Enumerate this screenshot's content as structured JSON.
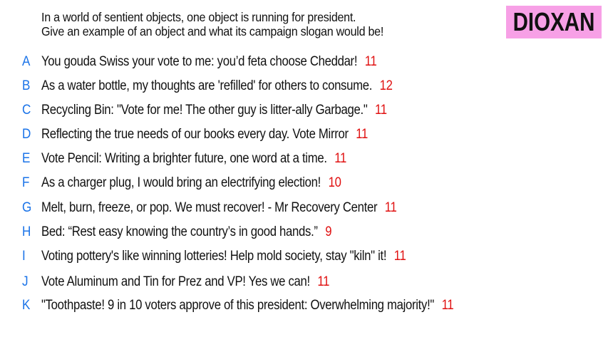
{
  "prompt": {
    "line1": "In a world of sentient objects, one object is running for president.",
    "line2": "Give an example of an object and what its campaign slogan would be!"
  },
  "badge": {
    "label": "DIOXAN",
    "color": "#f7a0e6"
  },
  "colors": {
    "letter": "#1a73e8",
    "score": "#e01010"
  },
  "answers": [
    {
      "letter": "A",
      "text": "You gouda Swiss your vote to me: you’d feta choose Cheddar!",
      "score": "11"
    },
    {
      "letter": "B",
      "text": "As a water bottle, my thoughts are 'refilled' for others to consume.",
      "score": "12"
    },
    {
      "letter": "C",
      "text": "Recycling Bin: \"Vote for me! The other guy is litter-ally Garbage.\"",
      "score": "11"
    },
    {
      "letter": "D",
      "text": "Reflecting the true needs of our books every day. Vote Mirror",
      "score": "11"
    },
    {
      "letter": "E",
      "text": "Vote Pencil: Writing a brighter future, one word at a time.",
      "score": "11"
    },
    {
      "letter": "F",
      "text": "As a charger plug, I would bring an electrifying election!",
      "score": "10"
    },
    {
      "letter": "G",
      "text": "Melt, burn, freeze, or pop. We must recover! - Mr Recovery Center",
      "score": "11"
    },
    {
      "letter": "H",
      "text": "Bed: “Rest easy knowing the country’s in good hands.”",
      "score": "9"
    },
    {
      "letter": "I",
      "text": "Voting pottery's like winning lotteries! Help mold society, stay \"kiln\" it!",
      "score": "11"
    },
    {
      "letter": "J",
      "text": "Vote Aluminum and Tin for Prez and VP! Yes we can!",
      "score": "11"
    },
    {
      "letter": "K",
      "text": "\"Toothpaste! 9 in 10 voters approve of this president: Overwhelming majority!\"",
      "score": "11"
    }
  ]
}
